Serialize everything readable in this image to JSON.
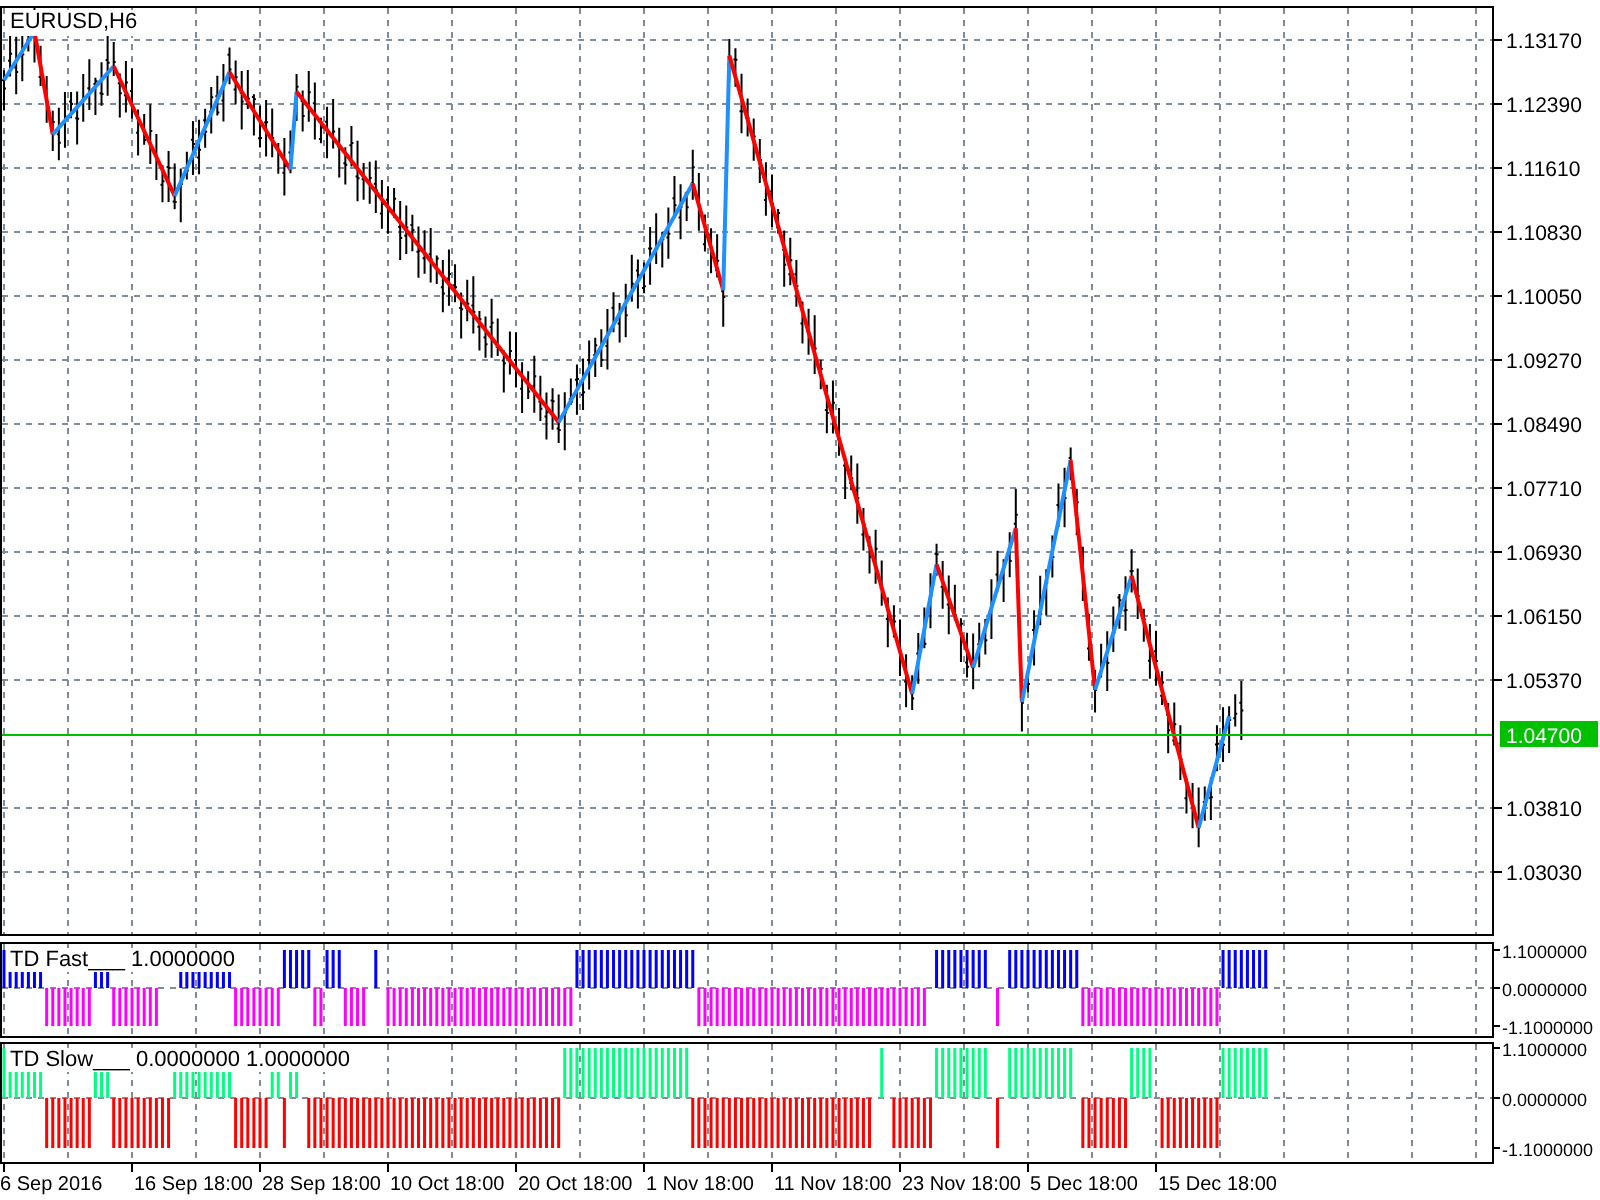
{
  "main_chart": {
    "title": "EURUSD,H6",
    "price_labels": [
      "1.13170",
      "1.12390",
      "1.11610",
      "1.10830",
      "1.10050",
      "1.09270",
      "1.08490",
      "1.07710",
      "1.06930",
      "1.06150",
      "1.05370",
      "1.03810",
      "1.03030"
    ],
    "current_price": "1.04700"
  },
  "indicators": [
    {
      "legend": "TD Fast___ 1.0000000",
      "axis_labels": [
        "1.1000000",
        "0.0000000",
        "-1.1000000"
      ]
    },
    {
      "legend": "TD Slow___ 0.0000000 1.0000000",
      "axis_labels": [
        "1.1000000",
        "0.0000000",
        "-1.1000000"
      ]
    }
  ],
  "time_axis": {
    "labels": [
      "6 Sep 2016",
      "16 Sep 18:00",
      "28 Sep 18:00",
      "10 Oct 18:00",
      "20 Oct 18:00",
      "1 Nov 18:00",
      "11 Nov 18:00",
      "23 Nov 18:00",
      "5 Dec 18:00",
      "15 Dec 18:00"
    ]
  }
}
